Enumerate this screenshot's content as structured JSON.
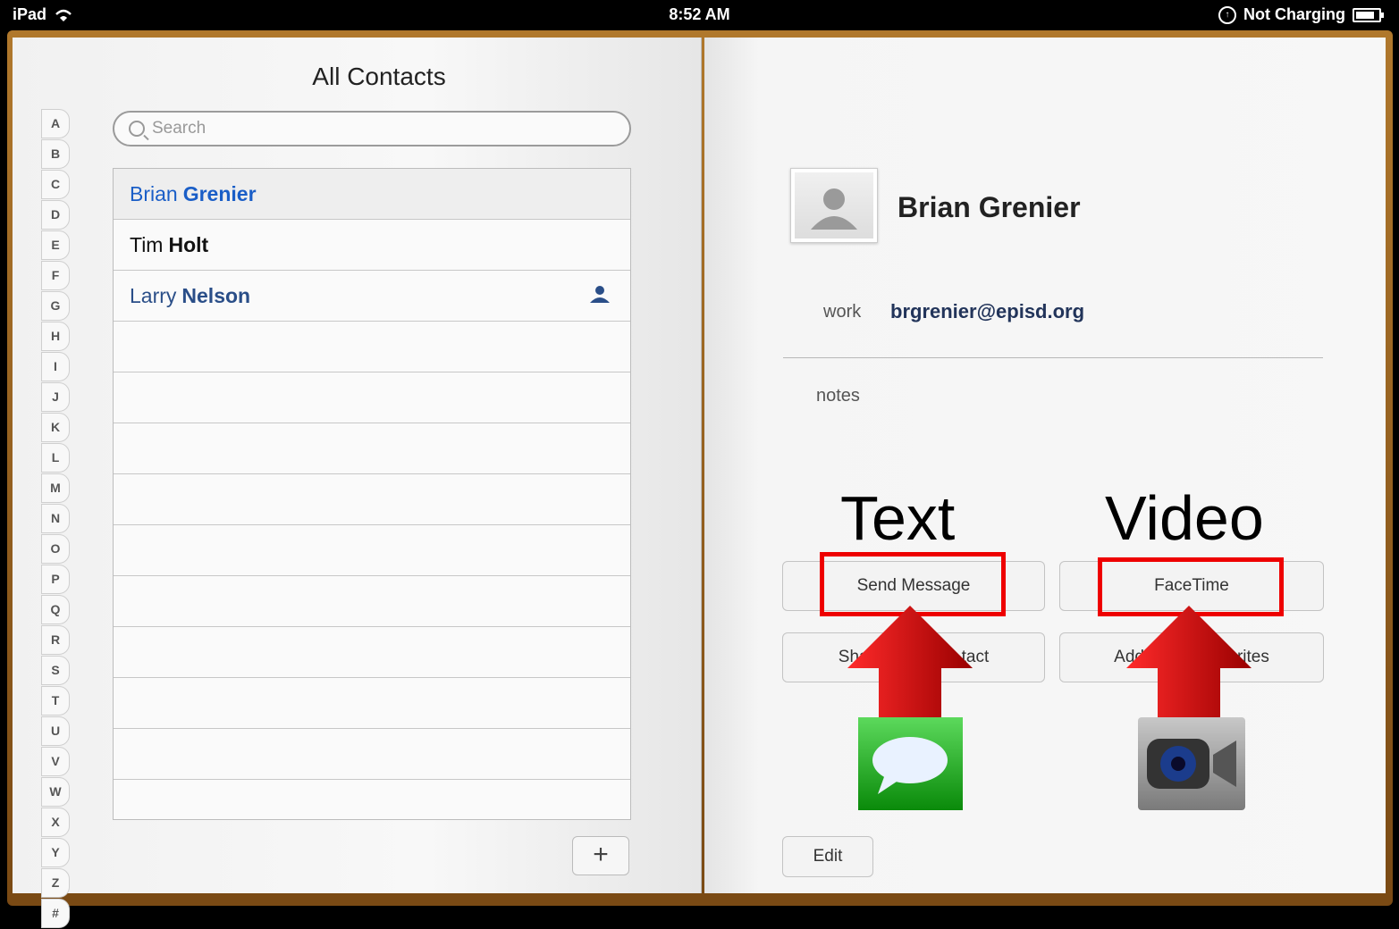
{
  "status": {
    "carrier": "iPad",
    "time": "8:52 AM",
    "charging": "Not Charging"
  },
  "left": {
    "title": "All Contacts",
    "search_placeholder": "Search",
    "alphabet": [
      "A",
      "B",
      "C",
      "D",
      "E",
      "F",
      "G",
      "H",
      "I",
      "J",
      "K",
      "L",
      "M",
      "N",
      "O",
      "P",
      "Q",
      "R",
      "S",
      "T",
      "U",
      "V",
      "W",
      "X",
      "Y",
      "Z",
      "#"
    ],
    "contacts": [
      {
        "first": "Brian",
        "last": "Grenier"
      },
      {
        "first": "Tim",
        "last": "Holt"
      },
      {
        "first": "Larry",
        "last": "Nelson"
      }
    ],
    "add_label": "+"
  },
  "right": {
    "name": "Brian Grenier",
    "work_label": "work",
    "email": "brgrenier@episd.org",
    "notes_label": "notes",
    "send_message": "Send Message",
    "facetime": "FaceTime",
    "share_contact": "Sha",
    "share_contact_tail": "tact",
    "add_favorites": "Add",
    "add_favorites_tail": "rites",
    "edit": "Edit"
  },
  "annotations": {
    "text_label": "Text",
    "video_label": "Video"
  },
  "colors": {
    "accent": "#1a5ec7",
    "annotation_red": "#e00000"
  }
}
